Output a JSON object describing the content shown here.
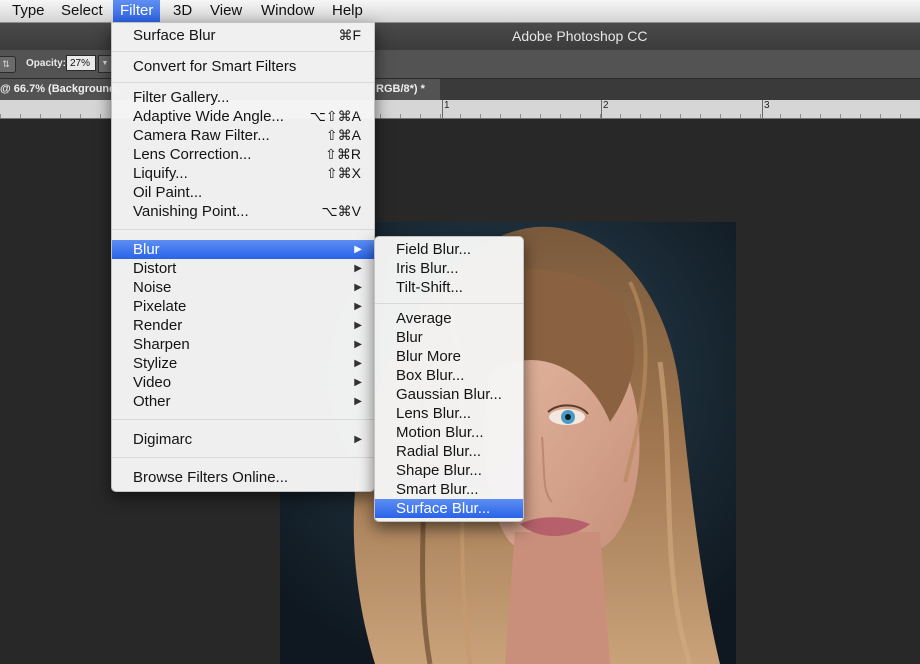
{
  "menubar": {
    "items": [
      "Type",
      "Select",
      "Filter",
      "3D",
      "View",
      "Window",
      "Help"
    ],
    "active": "Filter"
  },
  "app": {
    "title": "Adobe Photoshop CC"
  },
  "options": {
    "opacity_label": "Opacity:",
    "opacity_value": "27%"
  },
  "document": {
    "tab_left": "@ 66.7% (Background,",
    "tab_right": "RGB/8*) *",
    "ruler_numbers": [
      "1",
      "2",
      "3"
    ]
  },
  "filter_menu": {
    "items": [
      {
        "label": "Surface Blur",
        "shortcut": "⌘F"
      },
      {
        "label": "Convert for Smart Filters"
      },
      {
        "label": "Filter Gallery..."
      },
      {
        "label": "Adaptive Wide Angle...",
        "shortcut": "⌥⇧⌘A"
      },
      {
        "label": "Camera Raw Filter...",
        "shortcut": "⇧⌘A"
      },
      {
        "label": "Lens Correction...",
        "shortcut": "⇧⌘R"
      },
      {
        "label": "Liquify...",
        "shortcut": "⇧⌘X"
      },
      {
        "label": "Oil Paint..."
      },
      {
        "label": "Vanishing Point...",
        "shortcut": "⌥⌘V"
      },
      {
        "label": "Blur",
        "submenu": true,
        "highlighted": true
      },
      {
        "label": "Distort",
        "submenu": true
      },
      {
        "label": "Noise",
        "submenu": true
      },
      {
        "label": "Pixelate",
        "submenu": true
      },
      {
        "label": "Render",
        "submenu": true
      },
      {
        "label": "Sharpen",
        "submenu": true
      },
      {
        "label": "Stylize",
        "submenu": true
      },
      {
        "label": "Video",
        "submenu": true
      },
      {
        "label": "Other",
        "submenu": true
      },
      {
        "label": "Digimarc",
        "submenu": true
      },
      {
        "label": "Browse Filters Online..."
      }
    ]
  },
  "blur_submenu": {
    "items": [
      {
        "label": "Field Blur..."
      },
      {
        "label": "Iris Blur..."
      },
      {
        "label": "Tilt-Shift..."
      },
      {
        "label": "Average"
      },
      {
        "label": "Blur"
      },
      {
        "label": "Blur More"
      },
      {
        "label": "Box Blur..."
      },
      {
        "label": "Gaussian Blur..."
      },
      {
        "label": "Lens Blur..."
      },
      {
        "label": "Motion Blur..."
      },
      {
        "label": "Radial Blur..."
      },
      {
        "label": "Shape Blur..."
      },
      {
        "label": "Smart Blur..."
      },
      {
        "label": "Surface Blur...",
        "highlighted": true
      }
    ]
  },
  "colors": {
    "highlight": "#2d64e6",
    "canvas": "#282828",
    "menu_bg": "#f4f4f4"
  },
  "icons": {
    "submenu_arrow": "triangle-right-icon",
    "stepper": "up-down-stepper-icon",
    "dropdown": "chevron-down-icon"
  }
}
